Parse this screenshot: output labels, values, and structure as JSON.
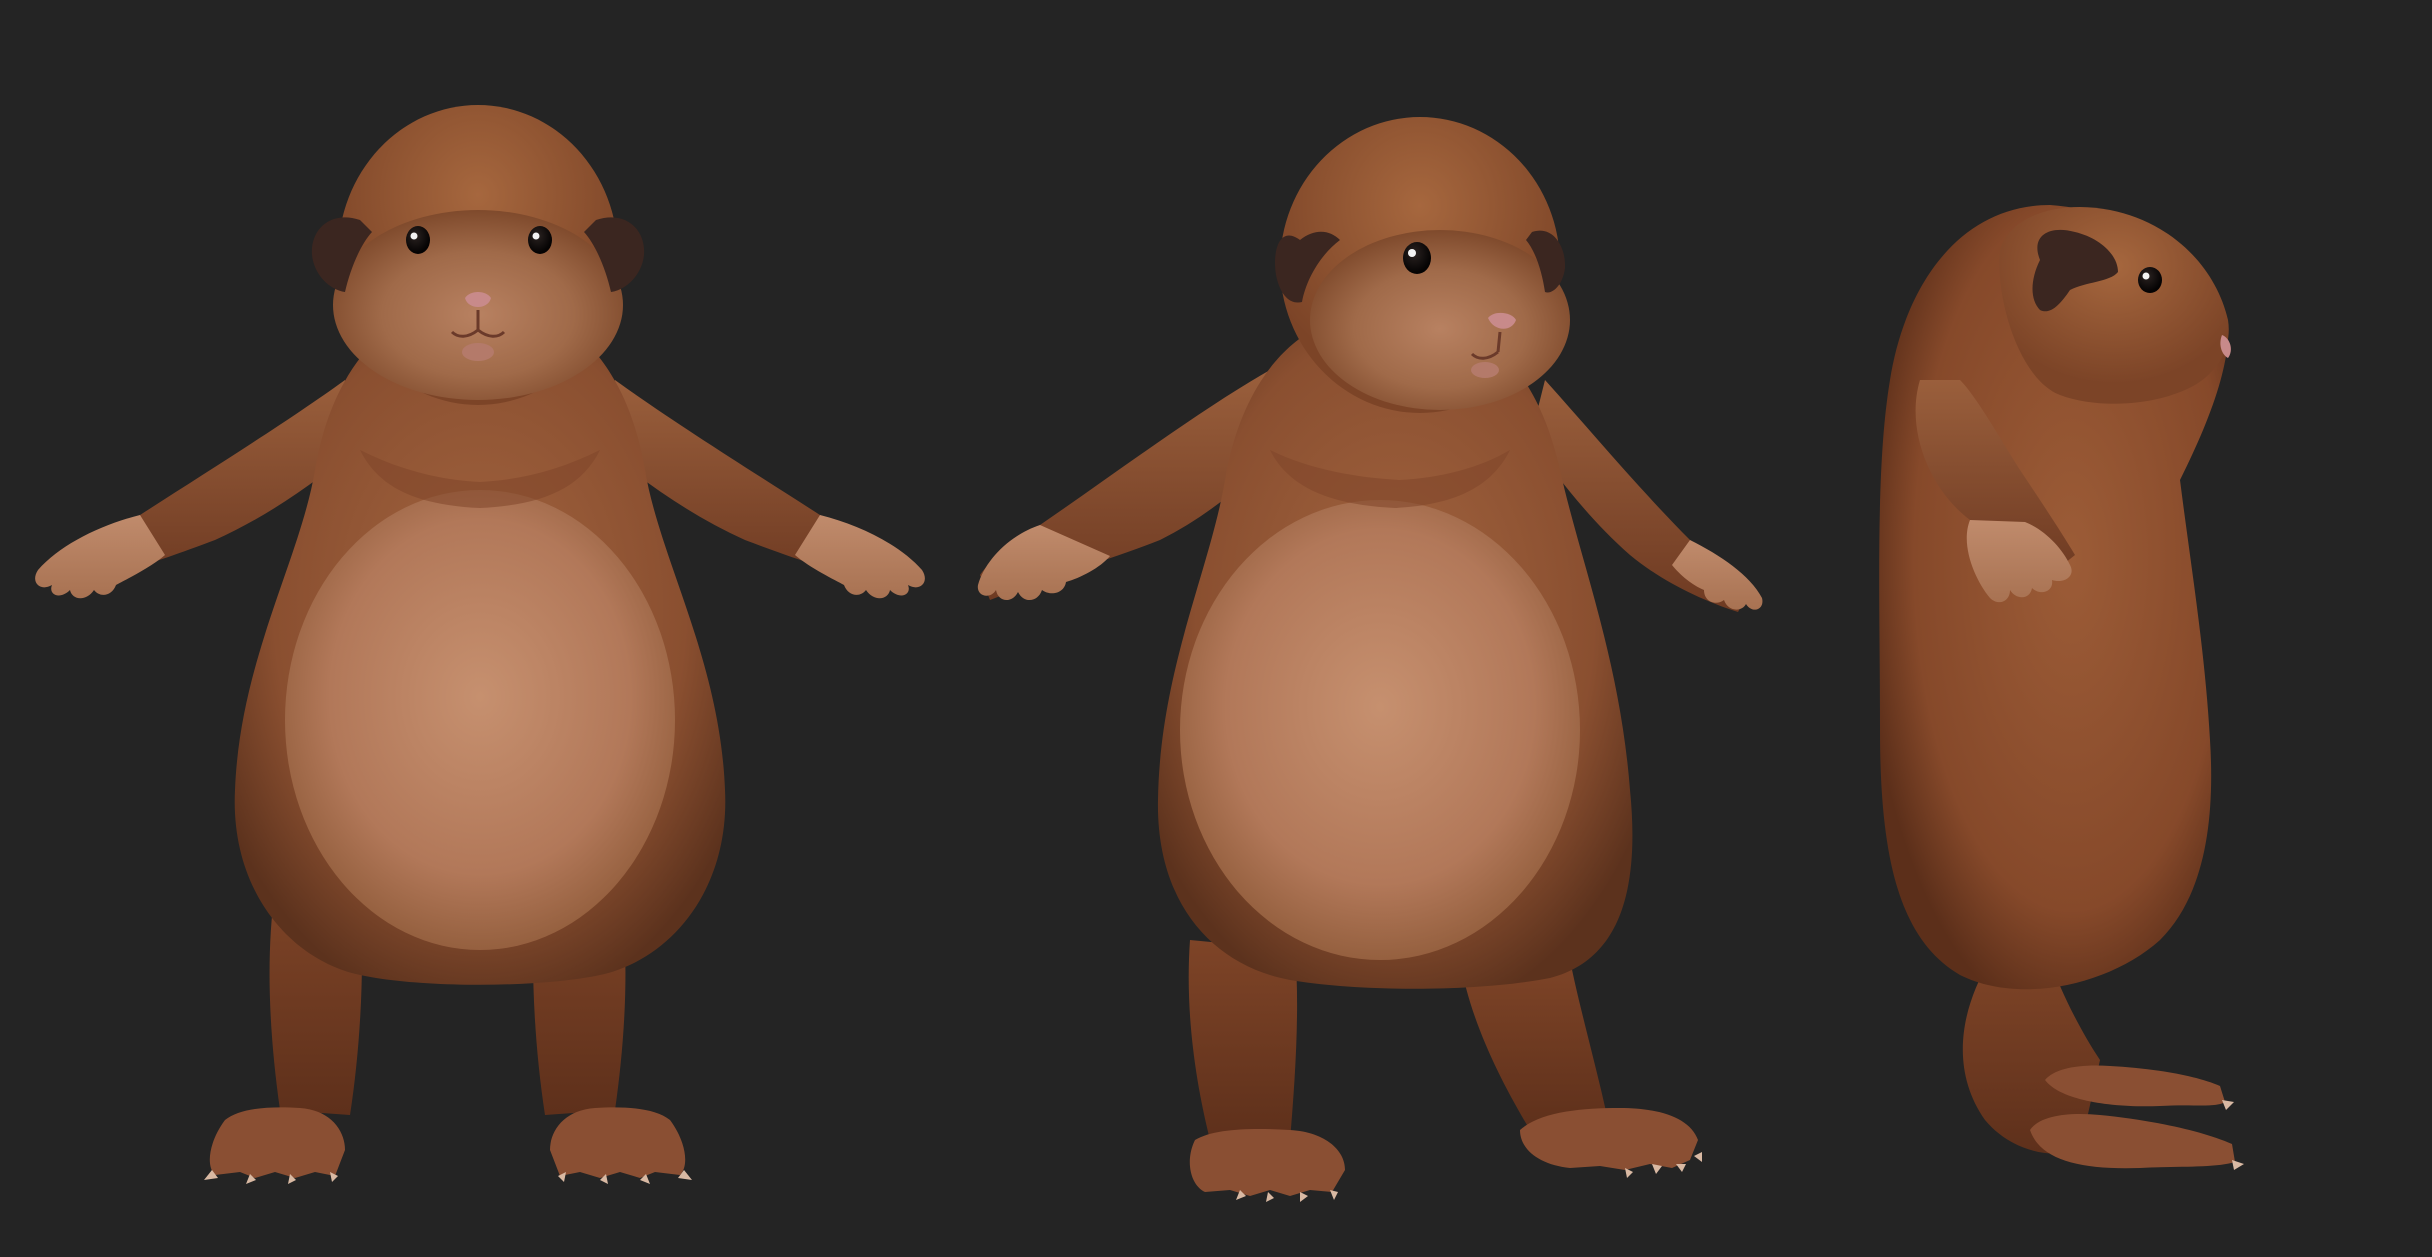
{
  "scene": {
    "background_color": "#242424",
    "fur_color": "#8f5433",
    "belly_color": "#b98160",
    "ear_color": "#3b2620",
    "nose_color": "#c88a8a",
    "eye_color": "#0d0908",
    "views": [
      "front",
      "three-quarter",
      "side"
    ]
  }
}
